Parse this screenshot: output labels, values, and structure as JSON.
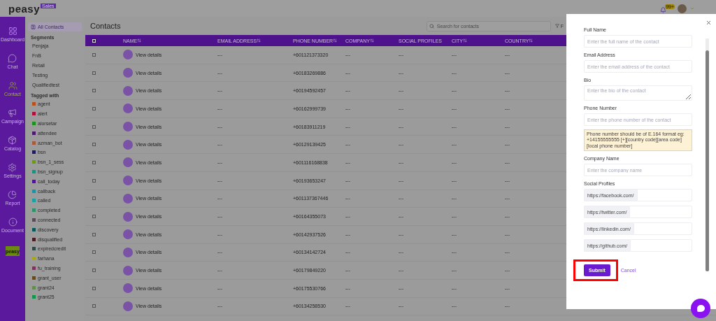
{
  "header": {
    "logo": "peasy",
    "logo_badge": "Sales",
    "notification_count": "99+"
  },
  "rail": [
    {
      "label": "Dashboard",
      "kind": "grid",
      "selected": false
    },
    {
      "label": "Chat",
      "kind": "chat",
      "selected": false
    },
    {
      "label": "Contact",
      "kind": "people",
      "selected": true
    },
    {
      "label": "Campaign",
      "kind": "megaphone",
      "selected": false
    },
    {
      "label": "Catalog",
      "kind": "box",
      "selected": false
    },
    {
      "label": "Settings",
      "kind": "gear",
      "selected": false
    },
    {
      "label": "Report",
      "kind": "pie",
      "selected": false
    },
    {
      "label": "Document",
      "kind": "info",
      "selected": false
    }
  ],
  "rail_logo": "peasy",
  "sidebar": {
    "all_contacts": {
      "label": "All Contacts",
      "selected": true
    },
    "segments_title": "Segments",
    "segments": [
      {
        "label": "Penjaja"
      },
      {
        "label": "FnB"
      },
      {
        "label": "Retail"
      },
      {
        "label": "Testing"
      },
      {
        "label": "Qualifiedtest"
      }
    ],
    "tags_title": "Tagged with",
    "tags": [
      {
        "label": "agent",
        "color": "#b6501c"
      },
      {
        "label": "alert",
        "color": "#a8123c"
      },
      {
        "label": "alorsetar",
        "color": "#1c941c"
      },
      {
        "label": "attendee",
        "color": "#4a1c6e"
      },
      {
        "label": "azman_bot",
        "color": "#a85a3c"
      },
      {
        "label": "bsn",
        "color": "#1c1c64"
      },
      {
        "label": "bsn_1_sess",
        "color": "#6c9a14"
      },
      {
        "label": "bsn_signup",
        "color": "#149482"
      },
      {
        "label": "call_today",
        "color": "#560fa0"
      },
      {
        "label": "callback",
        "color": "#1894a8"
      },
      {
        "label": "called",
        "color": "#1aa0a0"
      },
      {
        "label": "completed",
        "color": "#32906a"
      },
      {
        "label": "connected",
        "color": "#5a4a5a"
      },
      {
        "label": "discovery",
        "color": "#0c5858"
      },
      {
        "label": "disqualified",
        "color": "#4a1c24"
      },
      {
        "label": "expiredcredit",
        "color": "#264c4c"
      },
      {
        "label": "farhana",
        "color": "#a8a814"
      },
      {
        "label": "fu_training",
        "color": "#8a2c62"
      },
      {
        "label": "grant_user",
        "color": "#6a4a14"
      },
      {
        "label": "grant24",
        "color": "#5a9440"
      },
      {
        "label": "grant25",
        "color": "#14944a"
      }
    ]
  },
  "main": {
    "title": "Contacts",
    "search_placeholder": "Search for contacts",
    "filter_label": "F",
    "select_all_checked": false,
    "columns": [
      {
        "label": "NAME",
        "sortable": true
      },
      {
        "label": "EMAIL ADDRESS",
        "sortable": true
      },
      {
        "label": "PHONE NUMBER",
        "sortable": true
      },
      {
        "label": "COMPANY",
        "sortable": true
      },
      {
        "label": "SOCIAL PROFILES",
        "sortable": false
      },
      {
        "label": "CITY",
        "sortable": true
      },
      {
        "label": "COUNTRY",
        "sortable": true
      }
    ],
    "rows": [
      {
        "checked": false,
        "cells": [
          "View details",
          "---",
          "+601121373320",
          "---",
          "---",
          "---",
          "---"
        ]
      },
      {
        "checked": false,
        "cells": [
          "View details",
          "---",
          "+60183269886",
          "---",
          "---",
          "---",
          "---"
        ]
      },
      {
        "checked": false,
        "cells": [
          "View details",
          "---",
          "+60194592457",
          "---",
          "---",
          "---",
          "---"
        ]
      },
      {
        "checked": false,
        "cells": [
          "View details",
          "---",
          "+60162999739",
          "---",
          "---",
          "---",
          "---"
        ]
      },
      {
        "checked": false,
        "cells": [
          "View details",
          "---",
          "+60183911219",
          "---",
          "---",
          "---",
          "---"
        ]
      },
      {
        "checked": false,
        "cells": [
          "View details",
          "---",
          "+60129139425",
          "---",
          "---",
          "---",
          "---"
        ]
      },
      {
        "checked": false,
        "cells": [
          "View details",
          "---",
          "+601116168838",
          "---",
          "---",
          "---",
          "---"
        ]
      },
      {
        "checked": false,
        "cells": [
          "View details",
          "---",
          "+60193653247",
          "---",
          "---",
          "---",
          "---"
        ]
      },
      {
        "checked": false,
        "cells": [
          "View details",
          "---",
          "+601137367446",
          "---",
          "---",
          "---",
          "---"
        ]
      },
      {
        "checked": false,
        "cells": [
          "View details",
          "---",
          "+60164355073",
          "---",
          "---",
          "---",
          "---"
        ]
      },
      {
        "checked": false,
        "cells": [
          "View details",
          "---",
          "+60142937526",
          "---",
          "---",
          "---",
          "---"
        ]
      },
      {
        "checked": false,
        "cells": [
          "View details",
          "---",
          "+60134142724",
          "---",
          "---",
          "---",
          "---"
        ]
      },
      {
        "checked": false,
        "cells": [
          "View details",
          "---",
          "+60179849220",
          "---",
          "---",
          "---",
          "---"
        ]
      },
      {
        "checked": false,
        "cells": [
          "View details",
          "---",
          "+60175530766",
          "---",
          "---",
          "---",
          "---"
        ]
      },
      {
        "checked": false,
        "cells": [
          "View details",
          "---",
          "+60134258530",
          "---",
          "---",
          "---",
          "---"
        ]
      }
    ]
  },
  "drawer": {
    "fields": [
      {
        "label": "Full Name",
        "kind": "input",
        "placeholder": "Enter the full name of the contact"
      },
      {
        "label": "Email Address",
        "kind": "input",
        "placeholder": "Enter the email address of the contact"
      },
      {
        "label": "Bio",
        "kind": "textarea",
        "placeholder": "Enter the bio of the contact"
      },
      {
        "label": "Phone Number",
        "kind": "input",
        "placeholder": "Enter the phone number of the contact",
        "hint": "Phone number should be of E.164 format eg: +14155555555 [+][country code][area code][local phone number]"
      },
      {
        "label": "Company Name",
        "kind": "input",
        "placeholder": "Enter the company name"
      }
    ],
    "social_title": "Social Profiles",
    "social_prefixes": [
      "https://facebook.com/",
      "https://twitter.com/",
      "https://linkedin.com/",
      "https://github.com/"
    ],
    "submit": "Submit",
    "cancel": "Cancel",
    "submit_highlighted": true
  }
}
